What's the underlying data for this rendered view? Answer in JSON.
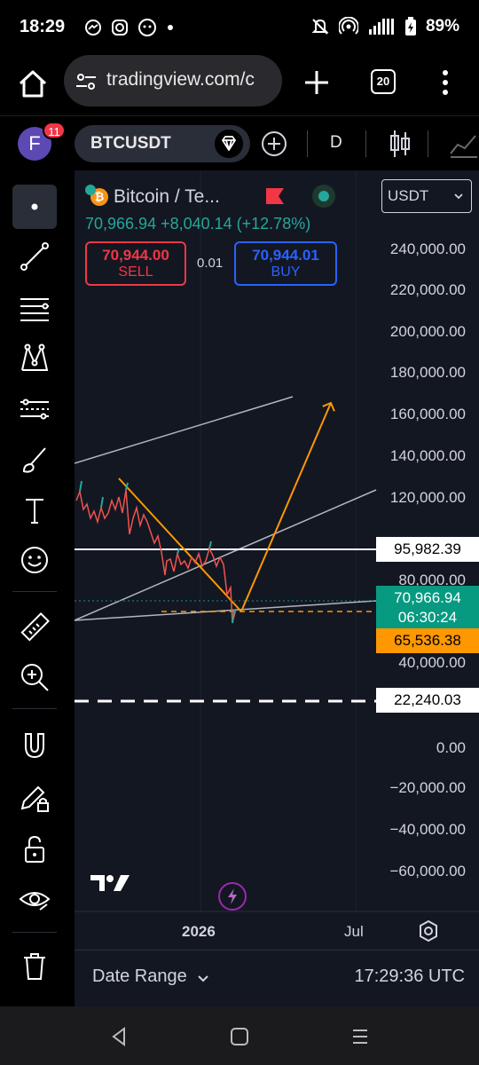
{
  "status_bar": {
    "time": "18:29",
    "battery": "89%",
    "icons": [
      "messenger-icon",
      "instagram-icon",
      "app-icon",
      "dot-icon",
      "mute-icon",
      "hotspot-icon",
      "signal-icon",
      "battery-icon"
    ]
  },
  "browser": {
    "url": "tradingview.com/c",
    "tab_count": "20"
  },
  "toolbar": {
    "avatar_letter": "F",
    "notification_count": "11",
    "symbol": "BTCUSDT",
    "interval": "D"
  },
  "legend": {
    "name": "Bitcoin / Te...",
    "price_line": "70,966.94  +8,040.14 (+12.78%)",
    "sell_price": "70,944.00",
    "sell_label": "SELL",
    "spread": "0.01",
    "buy_price": "70,944.01",
    "buy_label": "BUY",
    "currency": "USDT"
  },
  "y_axis": [
    "240,000.00",
    "220,000.00",
    "200,000.00",
    "180,000.00",
    "160,000.00",
    "140,000.00",
    "120,000.00",
    "80,000.00",
    "40,000.00",
    "0.00",
    "−20,000.00",
    "−40,000.00",
    "−60,000.00"
  ],
  "price_tags": {
    "horizontal_line": "95,982.39",
    "last_price": "70,966.94",
    "countdown": "06:30:24",
    "dashed_line": "65,536.38",
    "low_line": "22,240.03"
  },
  "x_axis": [
    "2026",
    "Jul"
  ],
  "bottom": {
    "date_range": "Date Range",
    "clock": "17:29:36 UTC"
  },
  "colors": {
    "up": "#26a69a",
    "down": "#f23645",
    "drawing": "#ff9800",
    "background": "#131722"
  }
}
